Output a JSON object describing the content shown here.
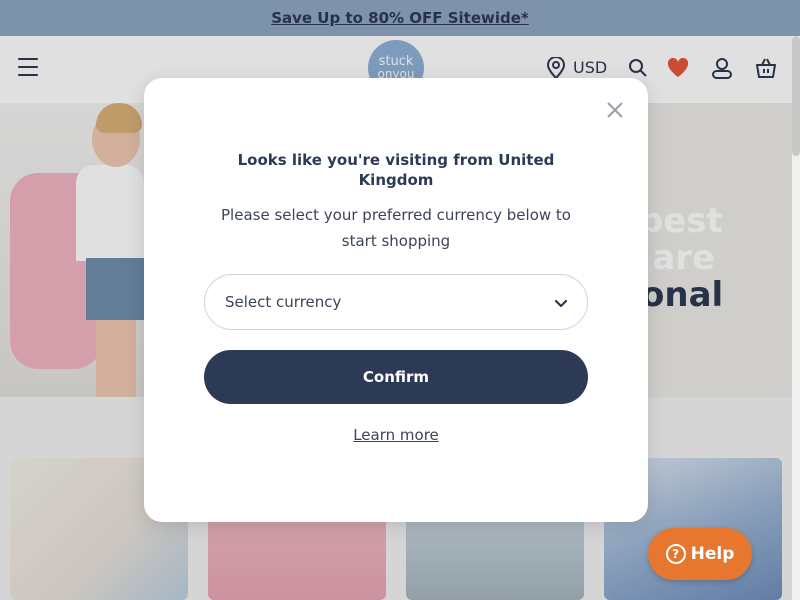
{
  "promo": {
    "text": "Save Up to 80% OFF Sitewide*"
  },
  "header": {
    "logo_line1": "stuck",
    "logo_line2": "onyou",
    "currency": "USD",
    "icons": [
      "menu-icon",
      "location-pin-icon",
      "search-icon",
      "heart-icon",
      "user-icon",
      "basket-icon"
    ]
  },
  "hero": {
    "headline_line1": "e best",
    "headline_line2": "ts are",
    "headline_line3": "rsonal"
  },
  "modal": {
    "title": "Looks like you're visiting from United Kingdom",
    "subtitle": "Please select your preferred currency below to start shopping",
    "select_placeholder": "Select currency",
    "confirm_label": "Confirm",
    "learn_more_label": "Learn more"
  },
  "help": {
    "label": "Help"
  },
  "colors": {
    "promo_bg": "#8fa8c4",
    "navy": "#2d3a55",
    "accent_orange": "#e7762f",
    "heart_red": "#e8573c",
    "logo_blue": "#8fb1d6"
  }
}
